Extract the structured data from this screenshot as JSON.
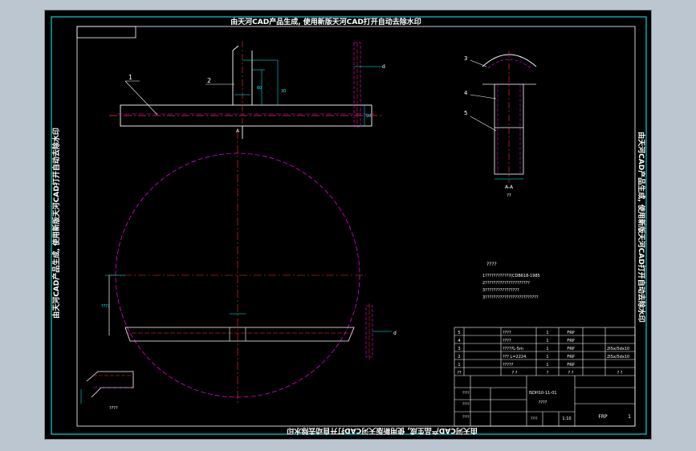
{
  "watermark": {
    "top": "由天河CAD产品生成, 使用新版天河CAD打开自动去除水印",
    "bottom": "由天河CAD产品生成, 使用新版天河CAD打开自动去除水印",
    "left": "由天河CAD产品生成, 使用新版天河CAD打开自动去除水印",
    "right": "由天河CAD产品生成, 使用新版天河CAD打开自动去除水印"
  },
  "labels": {
    "part1": "1",
    "part2": "2",
    "part3": "3",
    "part4": "4",
    "part5": "5",
    "sectionA": "A",
    "sectionAA": "A-A",
    "sectionScale": "??",
    "detailLabel": "????",
    "dimD": "d",
    "dim90": "90",
    "dim60": "60",
    "dim30": "30",
    "dimNote": "????"
  },
  "notes": {
    "title": "????",
    "lines": [
      "1????????????(CDB618-1985",
      "2?????????????????????",
      "3????????????????",
      "3?????????????????????????"
    ]
  },
  "titleBlock": {
    "rows": [
      {
        "no": "5",
        "name": "????",
        "qty": "1",
        "mat": "FRP",
        "note": ""
      },
      {
        "no": "4",
        "name": "????",
        "qty": "1",
        "mat": "FRP",
        "note": ""
      },
      {
        "no": "3",
        "name": "?????L-5m",
        "qty": "1",
        "mat": "FRP",
        "note": "2ISx/5dx10"
      },
      {
        "no": "2",
        "name": "??? L=2224",
        "qty": "1",
        "mat": "FRP",
        "note": "2ISx/5dx10"
      },
      {
        "no": "1",
        "name": "?????",
        "qty": "1",
        "mat": "FRP",
        "note": ""
      }
    ],
    "header": {
      "no": "??",
      "name": "? ?",
      "qty": "?",
      "mat": "? ?",
      "note": "? ?"
    },
    "drawingNo": "ISDH10-11-01",
    "drawingName": "????",
    "material": "FRP",
    "sheet": "1",
    "scale": "1:10",
    "misc": [
      "????",
      "????",
      "????",
      "????"
    ]
  }
}
